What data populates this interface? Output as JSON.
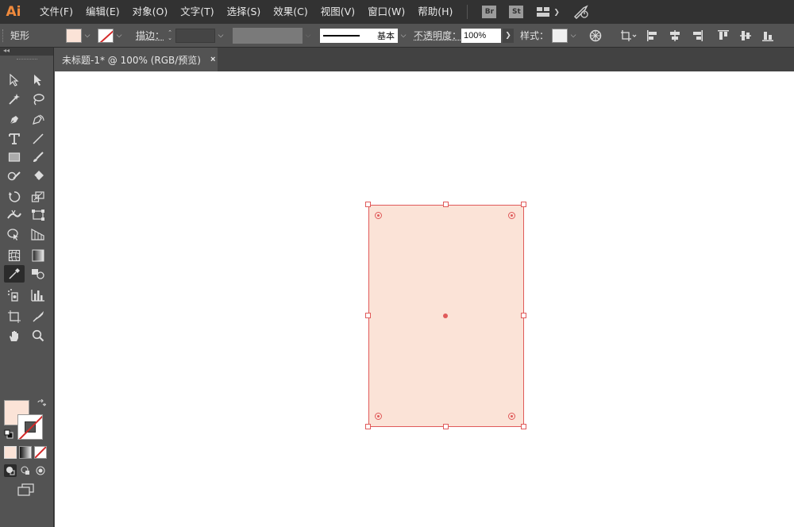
{
  "app": {
    "logo": "Ai"
  },
  "menu": [
    "文件(F)",
    "编辑(E)",
    "对象(O)",
    "文字(T)",
    "选择(S)",
    "效果(C)",
    "视图(V)",
    "窗口(W)",
    "帮助(H)"
  ],
  "bridge": {
    "br": "Br",
    "st": "St"
  },
  "control": {
    "object_type": "矩形",
    "stroke_label": "描边：",
    "brush_name": "基本",
    "opacity_label": "不透明度：",
    "opacity_value": "100%",
    "style_label": "样式："
  },
  "document": {
    "tab_title": "未标题-1* @ 100% (RGB/预览)",
    "close": "×"
  },
  "colors": {
    "fill": "#fbe3d7",
    "stroke_none": "#d42a2a",
    "selection": "#e05a5a",
    "logo": "#f08a3c"
  },
  "tools": [
    "selection-tool-icon",
    "direct-selection-tool-icon",
    "magic-wand-tool-icon",
    "lasso-tool-icon",
    "pen-tool-icon",
    "curvature-tool-icon",
    "type-tool-icon",
    "line-tool-icon",
    "rectangle-tool-icon",
    "paintbrush-tool-icon",
    "shaper-tool-icon",
    "eraser-tool-icon",
    "rotate-tool-icon",
    "scale-tool-icon",
    "width-tool-icon",
    "free-transform-tool-icon",
    "shape-builder-tool-icon",
    "perspective-grid-tool-icon",
    "mesh-tool-icon",
    "gradient-tool-icon",
    "eyedropper-tool-icon",
    "blend-tool-icon",
    "symbol-sprayer-tool-icon",
    "column-graph-tool-icon",
    "artboard-tool-icon",
    "slice-tool-icon",
    "hand-tool-icon",
    "zoom-tool-icon"
  ]
}
